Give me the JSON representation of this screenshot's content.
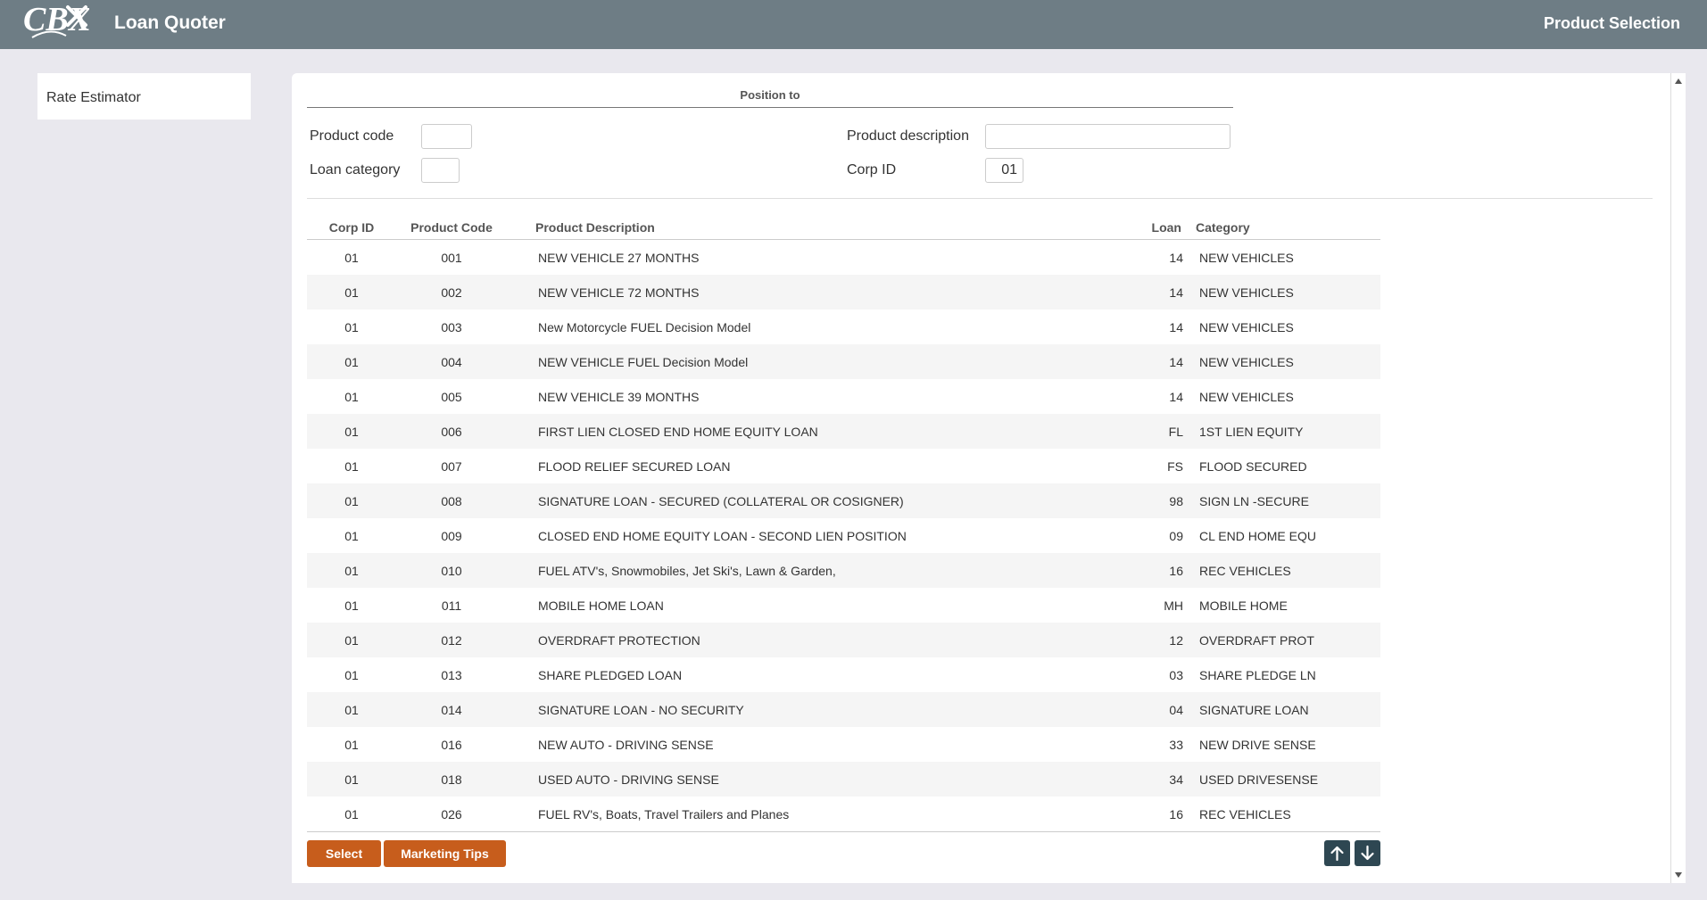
{
  "header": {
    "app_title": "Loan Quoter",
    "page_title": "Product Selection",
    "logo_text": "CBX"
  },
  "sidebar": {
    "items": [
      {
        "label": "Rate Estimator"
      }
    ]
  },
  "filters": {
    "section_title": "Position to",
    "product_code_label": "Product code",
    "product_code_value": "",
    "product_description_label": "Product description",
    "product_description_value": "",
    "loan_category_label": "Loan category",
    "loan_category_value": "",
    "corp_id_label": "Corp ID",
    "corp_id_value": "01"
  },
  "table": {
    "headers": {
      "corp_id": "Corp ID",
      "product_code": "Product Code",
      "product_description": "Product Description",
      "loan": "Loan",
      "category": "Category"
    },
    "rows": [
      {
        "corp": "01",
        "code": "001",
        "desc": "NEW VEHICLE 27 MONTHS",
        "loan": "14",
        "cat": "NEW VEHICLES"
      },
      {
        "corp": "01",
        "code": "002",
        "desc": "NEW VEHICLE 72 MONTHS",
        "loan": "14",
        "cat": "NEW VEHICLES"
      },
      {
        "corp": "01",
        "code": "003",
        "desc": "New Motorcycle FUEL Decision Model",
        "loan": "14",
        "cat": "NEW VEHICLES"
      },
      {
        "corp": "01",
        "code": "004",
        "desc": "NEW VEHICLE FUEL Decision Model",
        "loan": "14",
        "cat": "NEW VEHICLES"
      },
      {
        "corp": "01",
        "code": "005",
        "desc": "NEW VEHICLE 39 MONTHS",
        "loan": "14",
        "cat": "NEW VEHICLES"
      },
      {
        "corp": "01",
        "code": "006",
        "desc": "FIRST LIEN CLOSED END HOME EQUITY LOAN",
        "loan": "FL",
        "cat": "1ST LIEN EQUITY"
      },
      {
        "corp": "01",
        "code": "007",
        "desc": "FLOOD RELIEF SECURED LOAN",
        "loan": "FS",
        "cat": "FLOOD SECURED"
      },
      {
        "corp": "01",
        "code": "008",
        "desc": "SIGNATURE LOAN - SECURED (COLLATERAL OR COSIGNER)",
        "loan": "98",
        "cat": "SIGN LN -SECURE"
      },
      {
        "corp": "01",
        "code": "009",
        "desc": "CLOSED END HOME EQUITY LOAN - SECOND LIEN POSITION",
        "loan": "09",
        "cat": "CL END HOME EQU"
      },
      {
        "corp": "01",
        "code": "010",
        "desc": "FUEL ATV's, Snowmobiles, Jet Ski's, Lawn & Garden,",
        "loan": "16",
        "cat": "REC VEHICLES"
      },
      {
        "corp": "01",
        "code": "011",
        "desc": "MOBILE HOME LOAN",
        "loan": "MH",
        "cat": "MOBILE HOME"
      },
      {
        "corp": "01",
        "code": "012",
        "desc": "OVERDRAFT PROTECTION",
        "loan": "12",
        "cat": "OVERDRAFT PROT"
      },
      {
        "corp": "01",
        "code": "013",
        "desc": "SHARE PLEDGED LOAN",
        "loan": "03",
        "cat": "SHARE PLEDGE LN"
      },
      {
        "corp": "01",
        "code": "014",
        "desc": "SIGNATURE LOAN - NO SECURITY",
        "loan": "04",
        "cat": "SIGNATURE LOAN"
      },
      {
        "corp": "01",
        "code": "016",
        "desc": "NEW AUTO - DRIVING SENSE",
        "loan": "33",
        "cat": "NEW DRIVE SENSE"
      },
      {
        "corp": "01",
        "code": "018",
        "desc": "USED AUTO - DRIVING SENSE",
        "loan": "34",
        "cat": "USED DRIVESENSE"
      },
      {
        "corp": "01",
        "code": "026",
        "desc": "FUEL RV's, Boats, Travel Trailers and Planes",
        "loan": "16",
        "cat": "REC VEHICLES"
      }
    ]
  },
  "actions": {
    "select_label": "Select",
    "marketing_tips_label": "Marketing Tips"
  },
  "icons": {
    "page_up": "arrow-up-icon",
    "page_down": "arrow-down-icon"
  },
  "colors": {
    "header_bg": "#6e7d85",
    "button_accent": "#c75d1c",
    "nav_button": "#2e4752"
  }
}
